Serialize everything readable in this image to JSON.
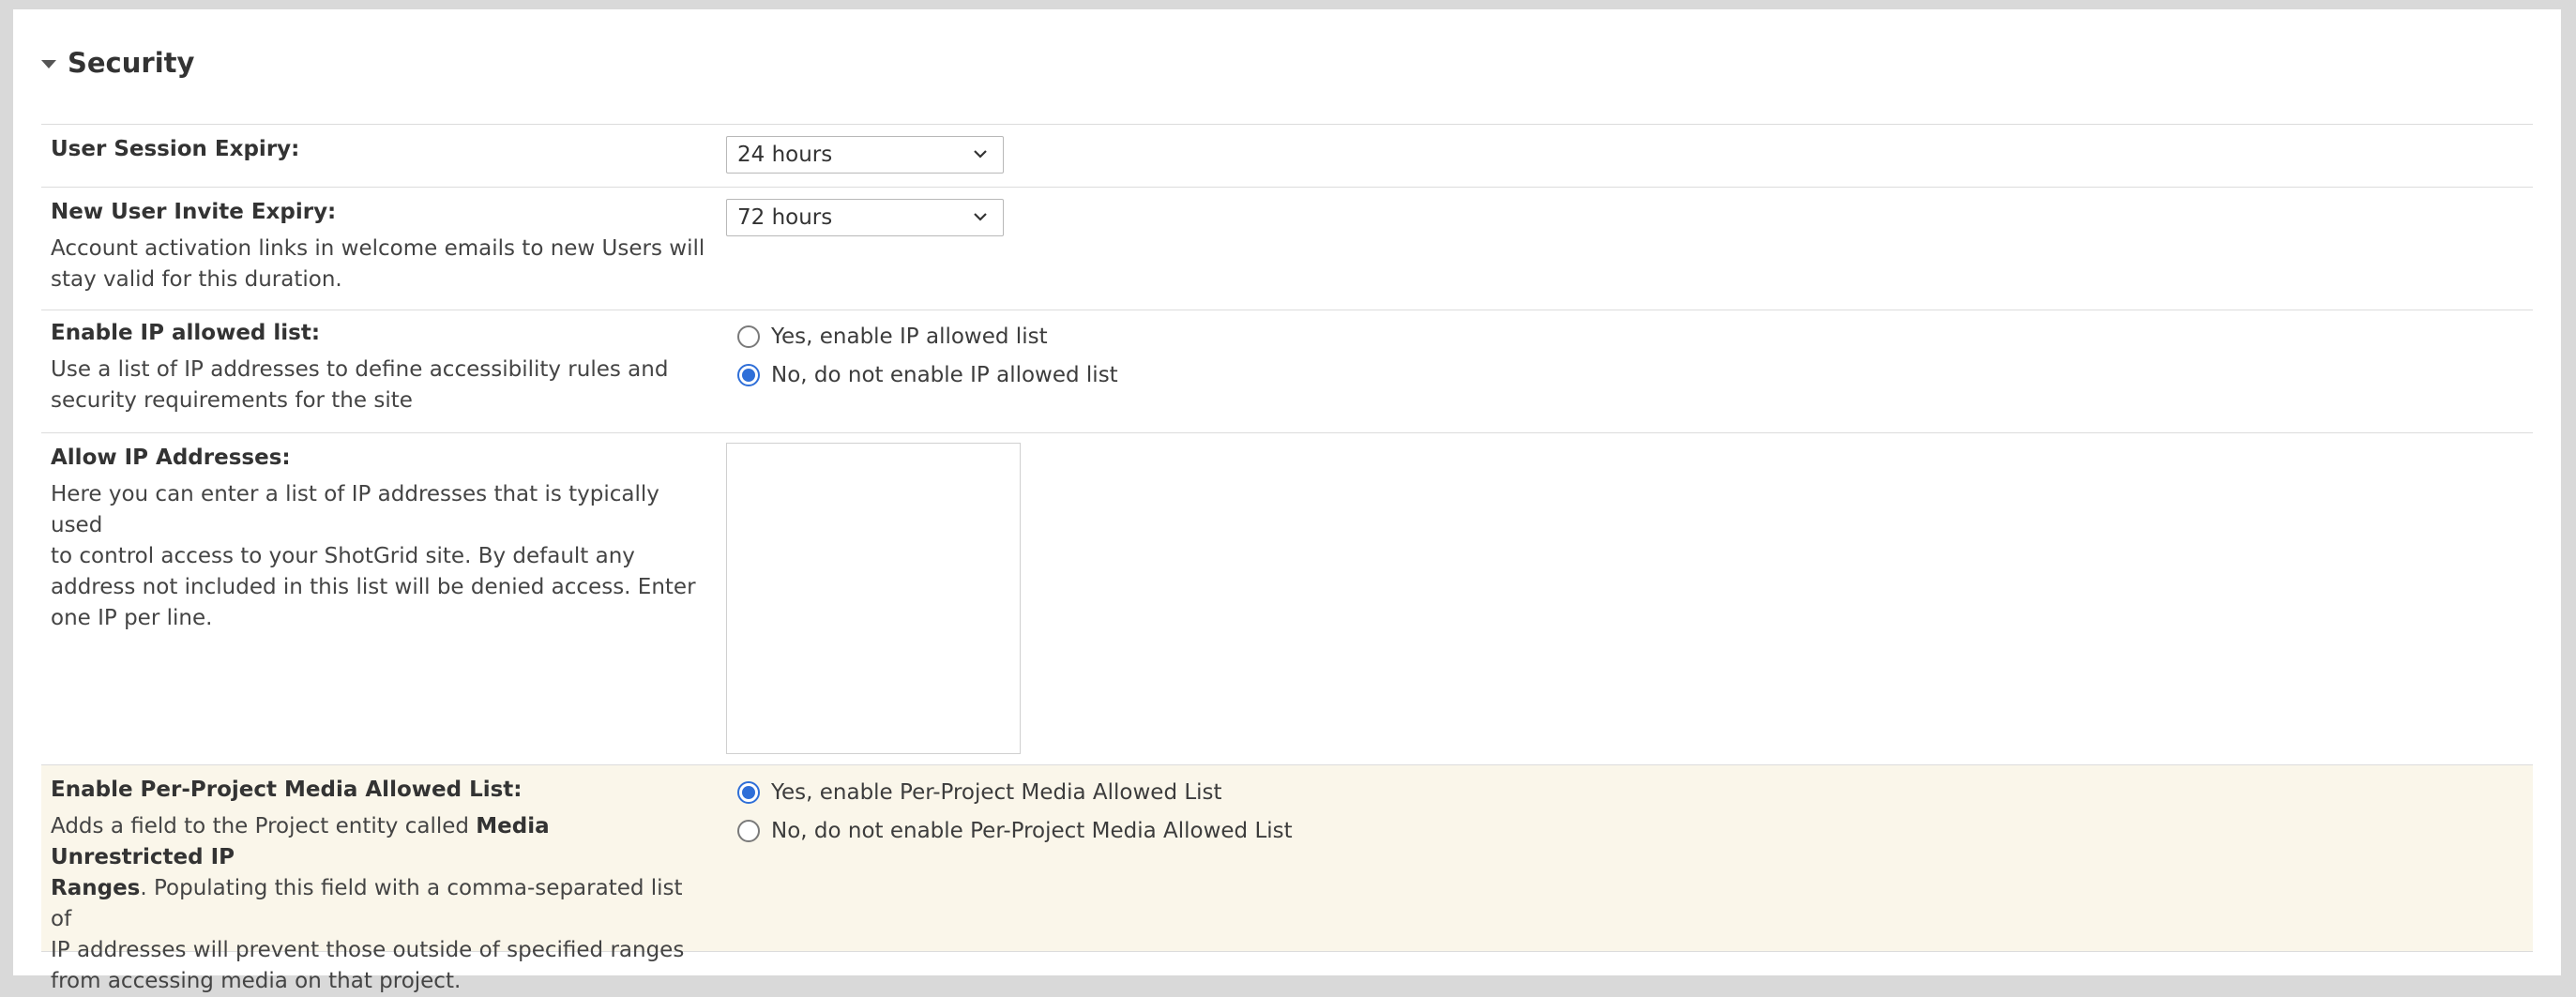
{
  "section": {
    "title": "Security",
    "rows": {
      "session_expiry": {
        "label": "User Session Expiry:",
        "value": "24 hours"
      },
      "invite_expiry": {
        "label": "New User Invite Expiry:",
        "description_line1": "Account activation links in welcome emails to new Users will",
        "description_line2": "stay valid for this duration.",
        "value": "72 hours"
      },
      "ip_allowed": {
        "label": "Enable IP allowed list:",
        "description_line1": "Use a list of IP addresses to define accessibility rules and",
        "description_line2": "security requirements for the site",
        "option_yes": "Yes, enable IP allowed list",
        "option_no": "No, do not enable IP allowed list",
        "selected": "no"
      },
      "allow_ips": {
        "label": "Allow IP Addresses:",
        "description_line1": "Here you can enter a list of IP addresses that is typically used",
        "description_line2": "to control access to your ShotGrid site. By default any",
        "description_line3": "address not included in this list will be denied access. Enter",
        "description_line4": "one IP per line.",
        "value": ""
      },
      "media_allowed": {
        "label": "Enable Per-Project Media Allowed List:",
        "description_pre": "Adds a field to the Project entity called ",
        "description_bold1": "Media Unrestricted IP",
        "description_bold2": "Ranges",
        "description_post1": ". Populating this field with a comma-separated list of",
        "description_line3": "IP addresses will prevent those outside of specified ranges",
        "description_line4": "from accessing media on that project.",
        "option_yes": "Yes, enable Per-Project Media Allowed List",
        "option_no": "No, do not enable Per-Project Media Allowed List",
        "selected": "yes"
      }
    }
  },
  "colors": {
    "accent": "#2f6fd8",
    "highlight_row": "#faf6ea",
    "divider": "#dcdcdc"
  }
}
